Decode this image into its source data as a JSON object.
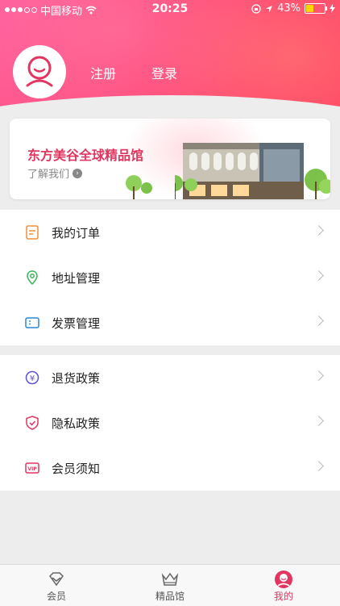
{
  "status_bar": {
    "carrier": "中国移动",
    "time": "20:25",
    "battery_percent": "43%",
    "battery_level": 0.43
  },
  "header": {
    "register_label": "注册",
    "login_label": "登录"
  },
  "banner": {
    "title": "东方美谷全球精品馆",
    "subtitle": "了解我们"
  },
  "menu_group_1": [
    {
      "label": "我的订单",
      "icon": "order-icon"
    },
    {
      "label": "地址管理",
      "icon": "location-pin-icon"
    },
    {
      "label": "发票管理",
      "icon": "invoice-icon"
    }
  ],
  "menu_group_2": [
    {
      "label": "退货政策",
      "icon": "refund-icon"
    },
    {
      "label": "隐私政策",
      "icon": "shield-icon"
    },
    {
      "label": "会员须知",
      "icon": "vip-icon"
    }
  ],
  "tabbar": {
    "tabs": [
      {
        "label": "会员",
        "icon": "diamond-icon"
      },
      {
        "label": "精品馆",
        "icon": "crown-icon"
      },
      {
        "label": "我的",
        "icon": "profile-icon"
      }
    ],
    "active_index": 2
  },
  "colors": {
    "accent": "#e23560",
    "header_gradient_start": "#ff5f9a",
    "header_gradient_end": "#ff3d5f"
  }
}
